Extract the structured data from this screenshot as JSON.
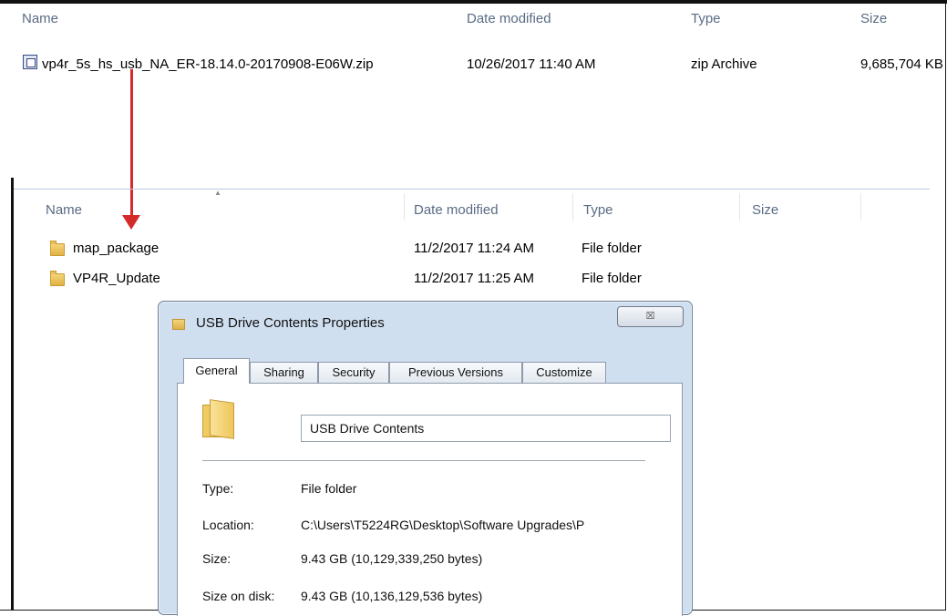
{
  "top_explorer": {
    "columns": {
      "name": "Name",
      "date_modified": "Date modified",
      "type": "Type",
      "size": "Size"
    },
    "file": {
      "icon": "zip-archive-icon",
      "name": "vp4r_5s_hs_usb_NA_ER-18.14.0-20170908-E06W.zip",
      "date_modified": "10/26/2017 11:40 AM",
      "type": "zip Archive",
      "size": "9,685,704 KB"
    }
  },
  "annotation": {
    "arrow_color": "#d42a2a"
  },
  "extracted_explorer": {
    "columns": {
      "name": "Name",
      "date_modified": "Date modified",
      "type": "Type",
      "size": "Size"
    },
    "rows": [
      {
        "icon": "folder-icon",
        "name": "map_package",
        "date_modified": "11/2/2017 11:24 AM",
        "type": "File folder"
      },
      {
        "icon": "folder-icon",
        "name": "VP4R_Update",
        "date_modified": "11/2/2017 11:25 AM",
        "type": "File folder"
      }
    ]
  },
  "properties_dialog": {
    "title": "USB Drive Contents Properties",
    "close_glyph": "☒",
    "tabs": [
      "General",
      "Sharing",
      "Security",
      "Previous Versions",
      "Customize"
    ],
    "active_tab": "General",
    "folder_name": "USB Drive Contents",
    "properties": [
      {
        "label": "Type:",
        "value": "File folder"
      },
      {
        "label": "Location:",
        "value": "C:\\Users\\T5224RG\\Desktop\\Software Upgrades\\P"
      },
      {
        "label": "Size:",
        "value": "9.43 GB (10,129,339,250 bytes)"
      },
      {
        "label": "Size on disk:",
        "value": "9.43 GB (10,136,129,536 bytes)"
      }
    ]
  }
}
